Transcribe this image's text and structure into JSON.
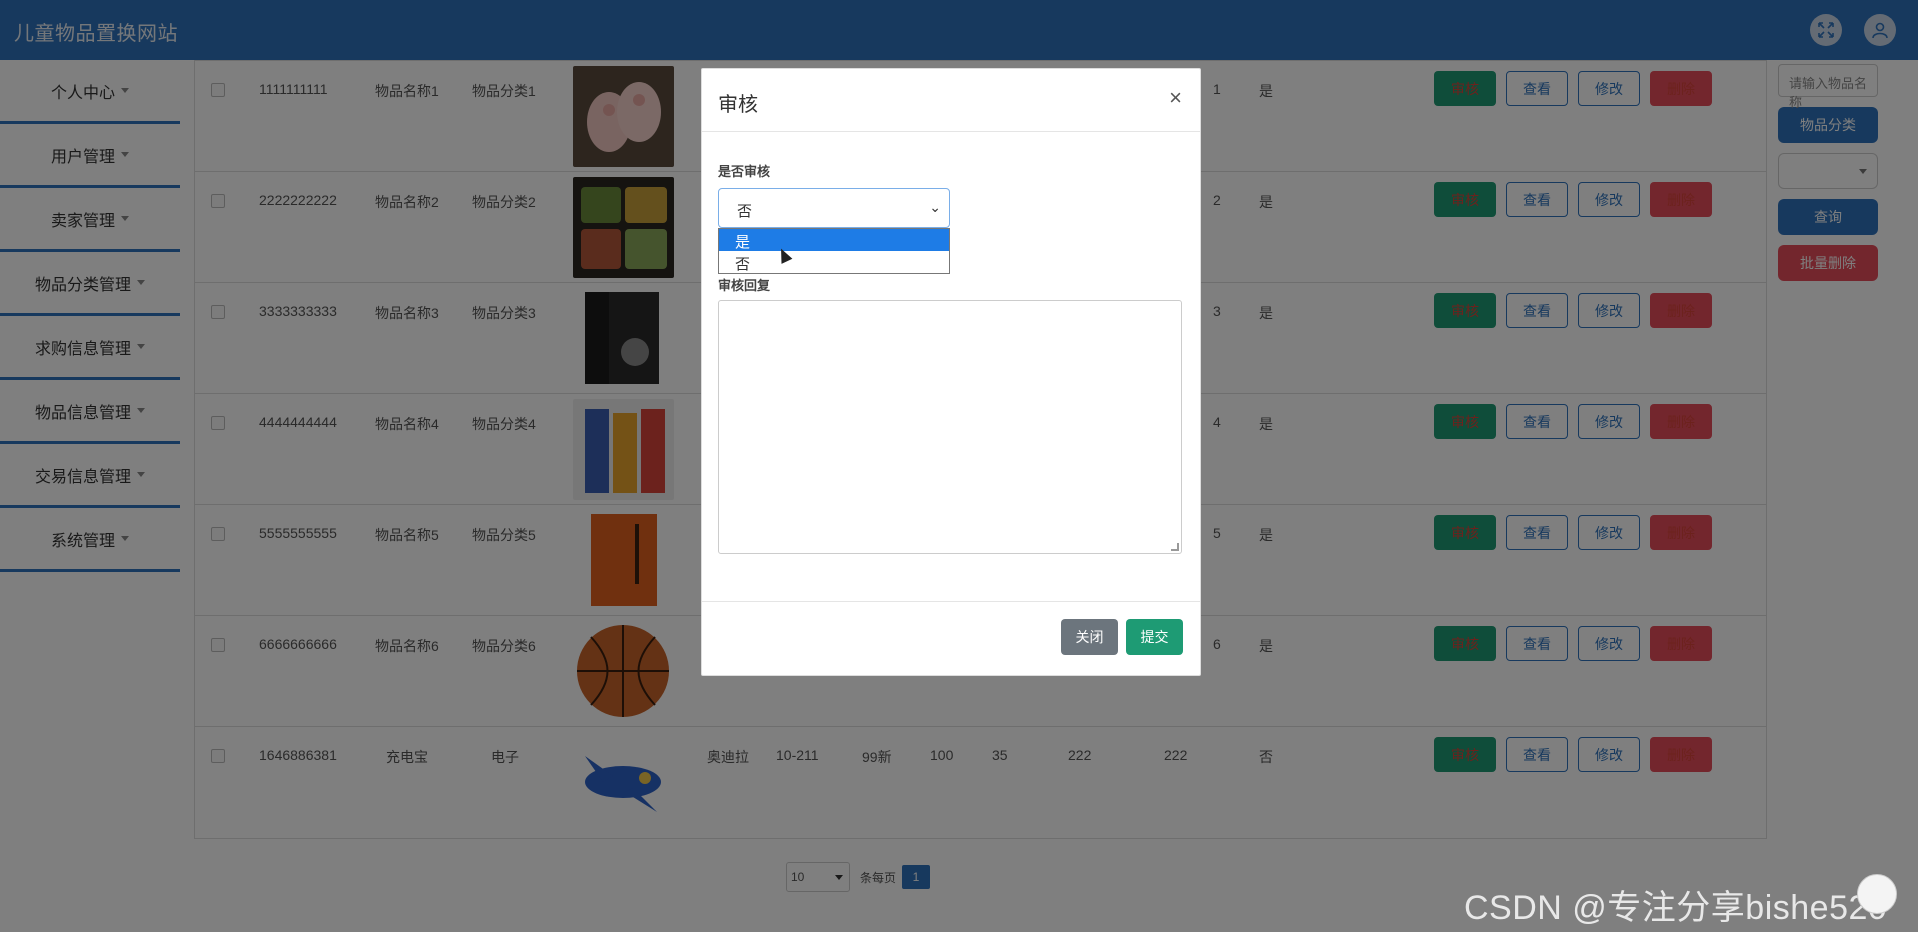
{
  "header": {
    "title": "儿童物品置换网站",
    "fullscreen_icon": "expand-icon",
    "user_icon": "user-icon"
  },
  "sidebar": {
    "items": [
      {
        "label": "个人中心"
      },
      {
        "label": "用户管理"
      },
      {
        "label": "卖家管理"
      },
      {
        "label": "物品分类管理"
      },
      {
        "label": "求购信息管理"
      },
      {
        "label": "物品信息管理"
      },
      {
        "label": "交易信息管理"
      },
      {
        "label": "系统管理"
      }
    ]
  },
  "table": {
    "rows": [
      {
        "code": "1111111111",
        "name": "物品名称1",
        "category": "分类1",
        "category_full": "物品分类1",
        "c1": "",
        "c2": "",
        "c3": "",
        "c4": "",
        "c5": "",
        "c6": "",
        "c7": "1",
        "flag": "是"
      },
      {
        "code": "2222222222",
        "name": "物品名称2",
        "category_full": "物品分类2",
        "c1": "",
        "c2": "",
        "c3": "",
        "c4": "",
        "c5": "",
        "c6": "",
        "c7": "2",
        "flag": "是"
      },
      {
        "code": "3333333333",
        "name": "物品名称3",
        "category_full": "物品分类3",
        "c1": "",
        "c2": "",
        "c3": "",
        "c4": "",
        "c5": "",
        "c6": "",
        "c7": "3",
        "flag": "是"
      },
      {
        "code": "4444444444",
        "name": "物品名称4",
        "category_full": "物品分类4",
        "c1": "",
        "c2": "",
        "c3": "",
        "c4": "",
        "c5": "",
        "c6": "",
        "c7": "4",
        "flag": "是"
      },
      {
        "code": "5555555555",
        "name": "物品名称5",
        "category_full": "物品分类5",
        "c1": "",
        "c2": "",
        "c3": "",
        "c4": "",
        "c5": "",
        "c6": "",
        "c7": "5",
        "flag": "是"
      },
      {
        "code": "6666666666",
        "name": "物品名称6",
        "category_full": "物品分类6",
        "c1": "",
        "c2": "",
        "c3": "",
        "c4": "",
        "c5": "",
        "c6": "",
        "c7": "6",
        "flag": "是"
      },
      {
        "code": "1646886381",
        "name": "充电宝",
        "category_full": "电子",
        "c1": "奥迪拉",
        "c2": "10-211",
        "c3": "99新",
        "c4": "100",
        "c5": "35",
        "c6": "222",
        "c7": "222",
        "flag": "否"
      }
    ],
    "buttons": {
      "audit": "审核",
      "view": "查看",
      "edit": "修改",
      "delete": "删除"
    }
  },
  "right_panel": {
    "search_placeholder": "请输入物品名称",
    "category_button": "物品分类",
    "query_button": "查询",
    "batch_delete_button": "批量删除"
  },
  "pagination": {
    "page_size": "10",
    "per_page_label": "条每页",
    "current_page": "1"
  },
  "modal": {
    "title": "审核",
    "close_symbol": "×",
    "audit_label": "是否审核",
    "selected_value": "否",
    "options": [
      "是",
      "否"
    ],
    "reply_label": "审核回复",
    "close_button": "关闭",
    "submit_button": "提交"
  },
  "watermark": "CSDN @专注分享bishe520",
  "colors": {
    "header": "#2e73bd",
    "audit_button": "#1e9b74",
    "delete_button": "#e74c5a",
    "submit_button": "#1e9b74",
    "close_button": "#6c757d"
  }
}
